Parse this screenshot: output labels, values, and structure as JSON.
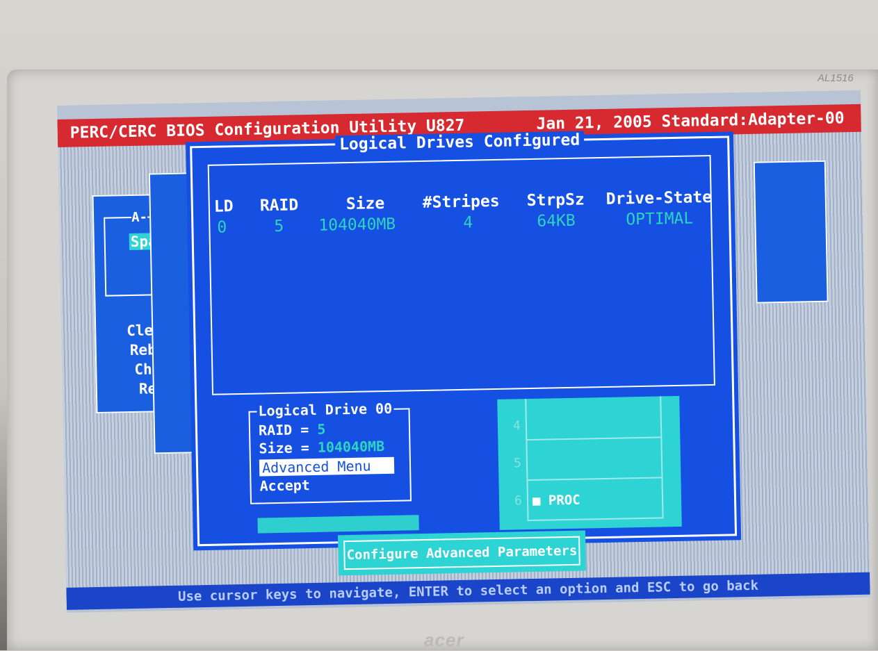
{
  "window": {
    "title_left": "PERC/CERC BIOS Configuration Utility U827",
    "title_right": "Jan 21, 2005 Standard:Adapter-00"
  },
  "background_menu": {
    "frame_label": "A-",
    "selected_item": "Spa",
    "items": [
      "Clear",
      "Rebui",
      "Check",
      "Recon"
    ]
  },
  "dialog": {
    "title": "Logical Drives Configured",
    "columns": [
      "LD",
      "RAID",
      "Size",
      "#Stripes",
      "StrpSz",
      "Drive-State"
    ],
    "rows": [
      {
        "ld": "0",
        "raid": "5",
        "size": "104040MB",
        "stripes": "4",
        "strpsz": "64KB",
        "state": "OPTIMAL"
      }
    ]
  },
  "logical_drive": {
    "title": "Logical Drive 00",
    "raid_label": "RAID = ",
    "raid_value": "5",
    "size_label": "Size = ",
    "size_value": "104040MB",
    "menu_items": [
      "Advanced Menu",
      "Accept"
    ],
    "selected_index": 0
  },
  "drive_map": {
    "slots": [
      "4",
      "5",
      "6"
    ],
    "proc_label": "PROC"
  },
  "configure_button": "Configure Advanced Parameters",
  "status_bar": "Use cursor keys to navigate, ENTER to select an option and ESC to go back",
  "monitor": {
    "model": "AL1516",
    "brand": "acer"
  },
  "colors": {
    "title_bar": "#d62a30",
    "panel_blue": "#1550e2",
    "value_cyan": "#2dd4bf",
    "highlight_cyan": "#2ed4d4"
  }
}
